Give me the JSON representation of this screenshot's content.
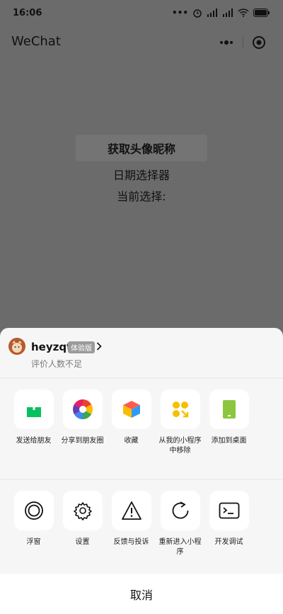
{
  "status": {
    "time": "16:06"
  },
  "app": {
    "title": "WeChat"
  },
  "content": {
    "button_label": "获取头像昵称",
    "line1": "日期选择器",
    "line2": "当前选择:"
  },
  "sheet": {
    "app_name": "heyzqt",
    "badge": "体验版",
    "subtitle": "评价人数不足",
    "row1": [
      {
        "label": "发送给朋友",
        "icon": "share-green-icon"
      },
      {
        "label": "分享到朋友圈",
        "icon": "moments-icon"
      },
      {
        "label": "收藏",
        "icon": "favorite-cube-icon"
      },
      {
        "label": "从我的小程序中移除",
        "icon": "remove-miniprogram-icon"
      },
      {
        "label": "添加到桌面",
        "icon": "add-to-desktop-icon"
      }
    ],
    "row2": [
      {
        "label": "浮窗",
        "icon": "float-window-icon"
      },
      {
        "label": "设置",
        "icon": "gear-icon"
      },
      {
        "label": "反馈与投诉",
        "icon": "warning-icon"
      },
      {
        "label": "重新进入小程序",
        "icon": "reload-icon"
      },
      {
        "label": "开发调试",
        "icon": "terminal-icon"
      }
    ],
    "cancel_label": "取消"
  }
}
